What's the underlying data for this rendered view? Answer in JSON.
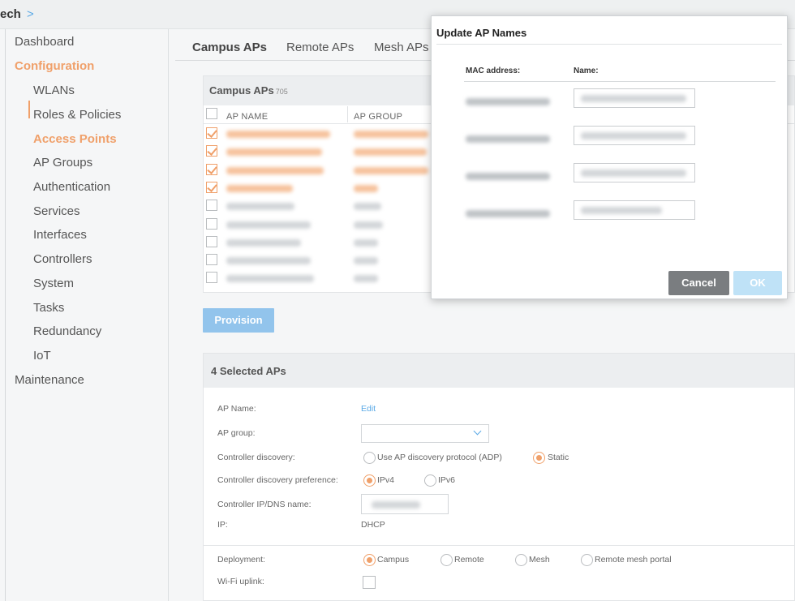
{
  "breadcrumb": {
    "text": "ech",
    "arrow": ">"
  },
  "sidebar": {
    "items": [
      {
        "label": "Dashboard"
      },
      {
        "label": "Configuration"
      },
      {
        "label": "WLANs"
      },
      {
        "label": "Roles & Policies"
      },
      {
        "label": "Access Points"
      },
      {
        "label": "AP Groups"
      },
      {
        "label": "Authentication"
      },
      {
        "label": "Services"
      },
      {
        "label": "Interfaces"
      },
      {
        "label": "Controllers"
      },
      {
        "label": "System"
      },
      {
        "label": "Tasks"
      },
      {
        "label": "Redundancy"
      },
      {
        "label": "IoT"
      },
      {
        "label": "Maintenance"
      }
    ]
  },
  "tabs": [
    {
      "label": "Campus APs"
    },
    {
      "label": "Remote APs"
    },
    {
      "label": "Mesh APs"
    }
  ],
  "campus_panel": {
    "title": "Campus APs",
    "count": "705",
    "columns": [
      "AP NAME",
      "AP GROUP"
    ],
    "rows_checked": [
      true,
      true,
      true,
      true,
      false,
      false,
      false,
      false,
      false
    ]
  },
  "provision_button": "Provision",
  "selected_panel": {
    "title": "4 Selected APs",
    "fields": {
      "ap_name_label": "AP Name:",
      "ap_name_edit": "Edit",
      "ap_group_label": "AP group:",
      "discovery_label": "Controller discovery:",
      "discovery_adp": "Use AP discovery protocol (ADP)",
      "discovery_static": "Static",
      "pref_label": "Controller discovery preference:",
      "pref_ipv4": "IPv4",
      "pref_ipv6": "IPv6",
      "ctrl_ip_label": "Controller IP/DNS name:",
      "ip_label": "IP:",
      "ip_value": "DHCP",
      "deployment_label": "Deployment:",
      "dep_campus": "Campus",
      "dep_remote": "Remote",
      "dep_mesh": "Mesh",
      "dep_rmp": "Remote mesh portal",
      "uplink_label": "Wi-Fi uplink:"
    }
  },
  "modal": {
    "title": "Update AP Names",
    "col_mac": "MAC address:",
    "col_name": "Name:",
    "cancel": "Cancel",
    "ok": "OK"
  },
  "colors": {
    "accent": "#f0a06a",
    "link": "#5aa9e6",
    "primary_button": "#92c4ec"
  }
}
